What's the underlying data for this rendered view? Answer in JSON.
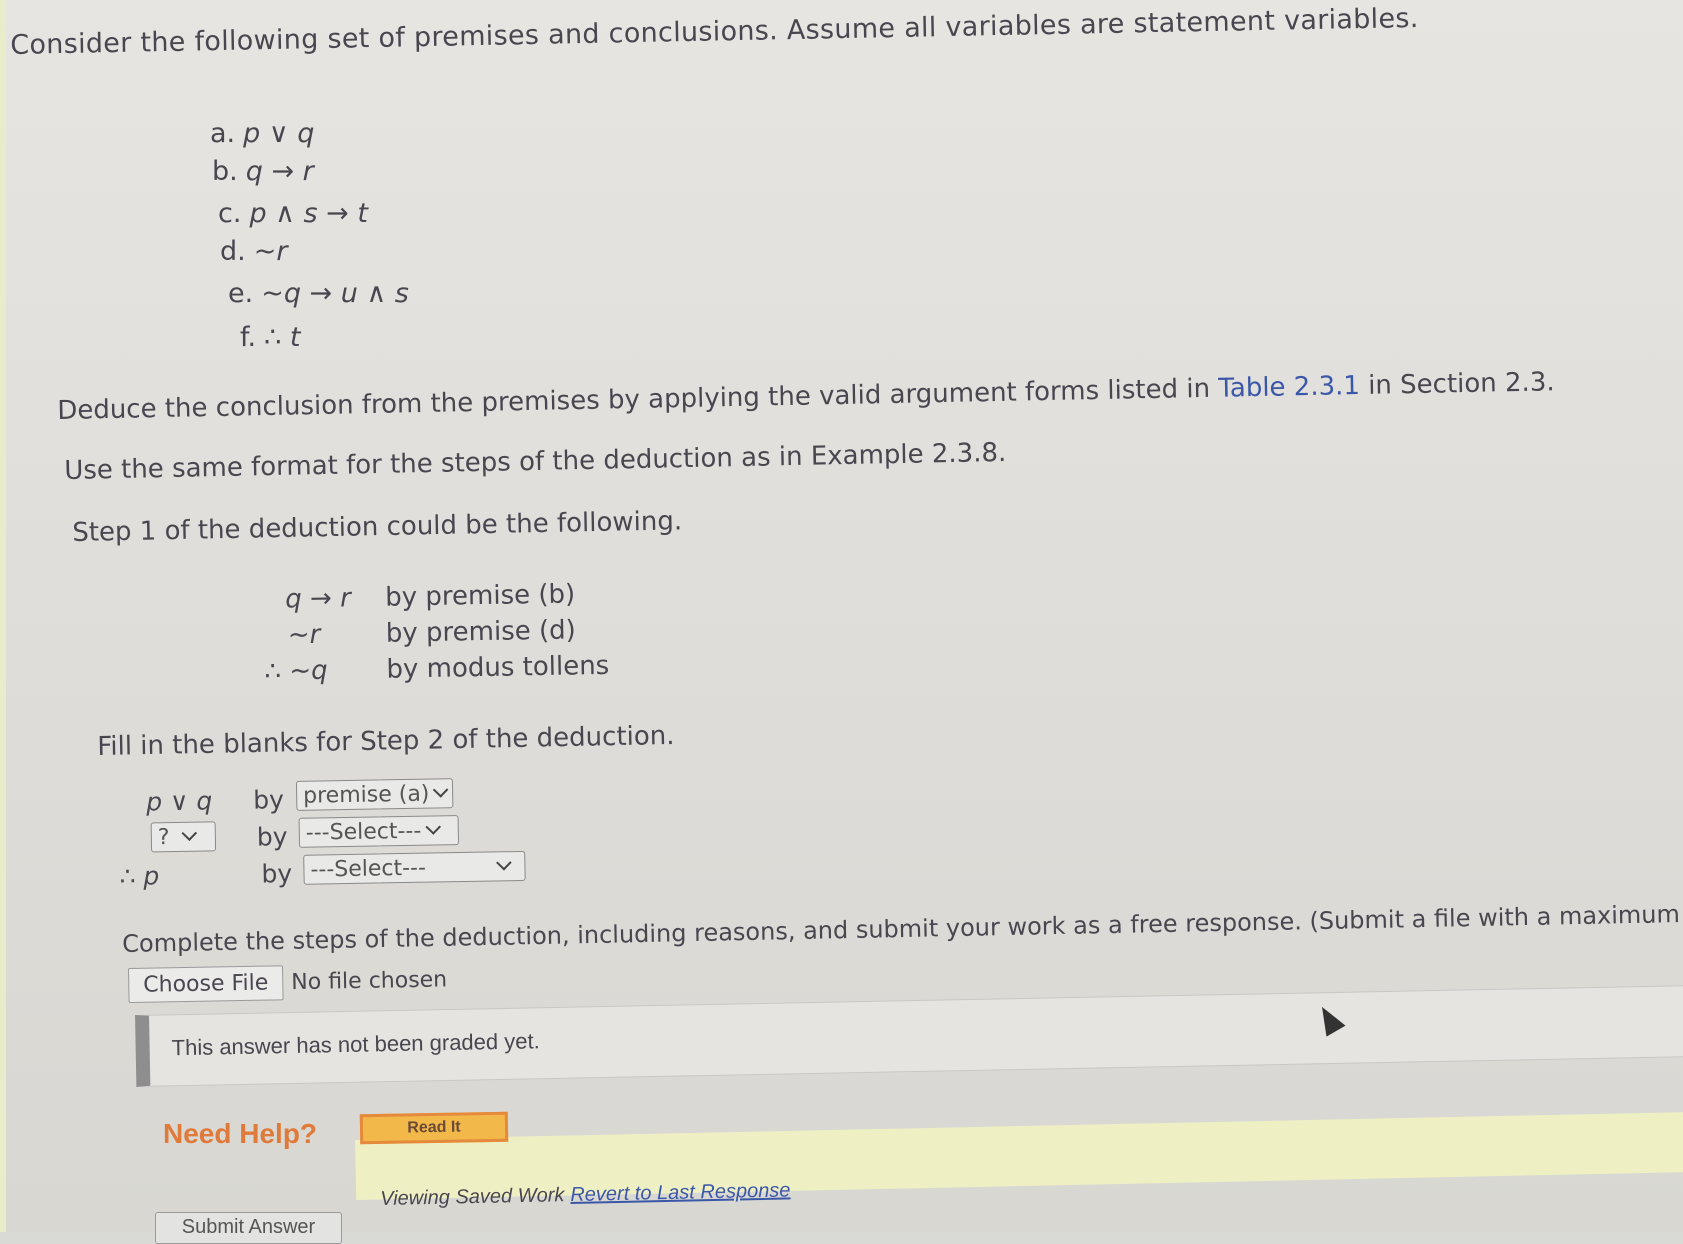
{
  "intro": "Consider the following set of premises and conclusions. Assume all variables are statement variables.",
  "premises": [
    {
      "label": "a.",
      "expr": "p ∨ q"
    },
    {
      "label": "b.",
      "expr": "q → r"
    },
    {
      "label": "c.",
      "expr": "p ∧ s → t"
    },
    {
      "label": "d.",
      "expr": "~r"
    },
    {
      "label": "e.",
      "expr": "~q → u ∧ s"
    },
    {
      "label": "f.",
      "expr": "∴ t"
    }
  ],
  "deduce": {
    "before": "Deduce the conclusion from the premises by applying the valid argument forms listed in ",
    "link": "Table 2.3.1",
    "after": " in Section 2.3."
  },
  "format_text": "Use the same format for the steps of the deduction as in Example 2.3.8.",
  "step1_intro": "Step 1 of the deduction could be the following.",
  "step1": [
    {
      "stmt": "q → r",
      "reason": "by premise (b)"
    },
    {
      "stmt": "~r",
      "reason": "by premise (d)"
    },
    {
      "stmt": "∴ ~q",
      "reason": "by modus tollens"
    }
  ],
  "step2_intro": "Fill in the blanks for Step 2 of the deduction.",
  "step2": {
    "by_label": "by",
    "row1": {
      "stmt": "p ∨ q",
      "select": "premise (a)"
    },
    "row2": {
      "stmt_select": "?",
      "select": "---Select---"
    },
    "row3": {
      "stmt": "∴ p",
      "select": "---Select---"
    }
  },
  "complete_text": "Complete the steps of the deduction, including reasons, and submit your work as a free response. (Submit a file with a maximum",
  "file": {
    "button": "Choose File",
    "status": "No file chosen"
  },
  "graded_text": "This answer has not been graded yet.",
  "help": {
    "label": "Need Help?",
    "read_it": "Read It"
  },
  "viewing": {
    "text": "Viewing Saved Work",
    "revert": "Revert to Last Response"
  },
  "submit": "Submit Answer"
}
